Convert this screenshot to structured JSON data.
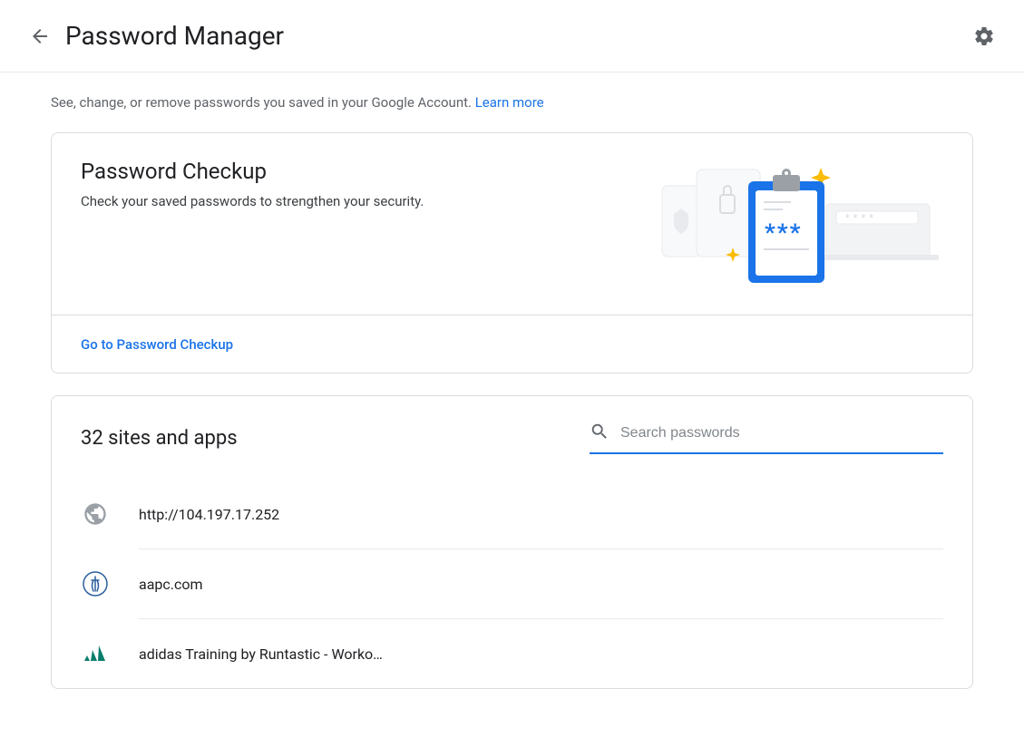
{
  "header": {
    "title": "Password Manager"
  },
  "intro": {
    "text": "See, change, or remove passwords you saved in your Google Account. ",
    "learn_more": "Learn more"
  },
  "checkup": {
    "title": "Password Checkup",
    "description": "Check your saved passwords to strengthen your security.",
    "link_label": "Go to Password Checkup"
  },
  "sites": {
    "title": "32 sites and apps",
    "search_placeholder": "Search passwords",
    "items": [
      {
        "label": "http://104.197.17.252",
        "icon": "globe"
      },
      {
        "label": "aapc.com",
        "icon": "aapc"
      },
      {
        "label": "adidas Training by Runtastic - Worko…",
        "icon": "adidas"
      }
    ]
  }
}
